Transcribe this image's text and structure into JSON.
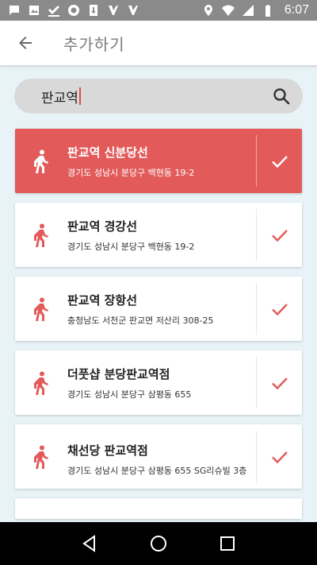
{
  "status_bar": {
    "time": "6:07",
    "left_icons": [
      "message-icon",
      "image-icon",
      "check-icon",
      "shield-icon",
      "download-icon",
      "app-icon",
      "app-icon"
    ],
    "right_icons": [
      "location-icon",
      "wifi-icon",
      "signal-icon",
      "battery-icon"
    ]
  },
  "app_bar": {
    "title": "추가하기",
    "back_icon": "arrow-back-icon"
  },
  "search": {
    "value": "판교역",
    "icon": "search-icon"
  },
  "colors": {
    "accent": "#e25a5a",
    "background": "#e8f3f8"
  },
  "results": [
    {
      "name": "판교역 신분당선",
      "address": "경기도 성남시 분당구 백현동 19-2",
      "selected": true
    },
    {
      "name": "판교역 경강선",
      "address": "경기도 성남시 분당구 백현동 19-2",
      "selected": false
    },
    {
      "name": "판교역 장항선",
      "address": "충청남도 서천군 판교면 저산리 308-25",
      "selected": false
    },
    {
      "name": "더풋샵 분당판교역점",
      "address": "경기도 성남시 분당구 삼평동 655",
      "selected": false
    },
    {
      "name": "채선당 판교역점",
      "address": "경기도 성남시 분당구 삼평동 655 SG리슈빌 3층",
      "selected": false
    }
  ],
  "nav": [
    "back-triangle-icon",
    "home-circle-icon",
    "recents-square-icon"
  ]
}
